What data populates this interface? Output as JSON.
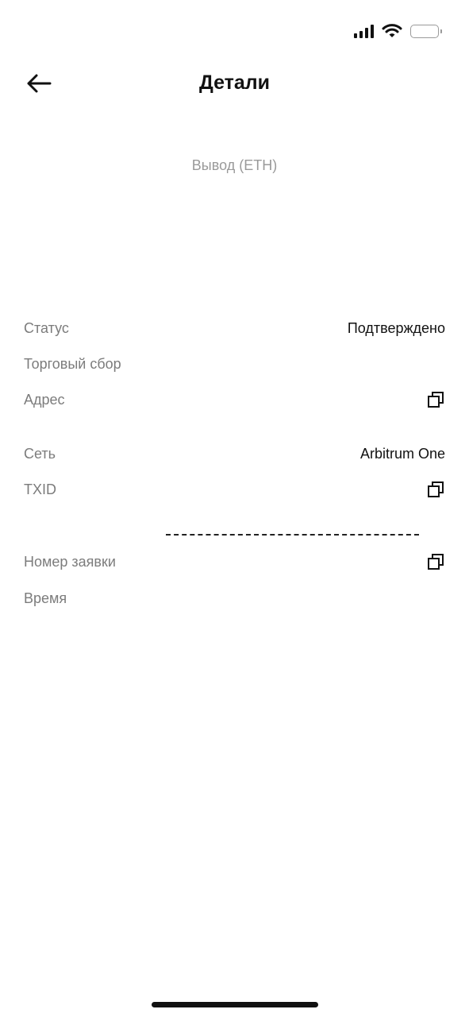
{
  "header": {
    "title": "Детали"
  },
  "subtitle": "Вывод (ETH)",
  "details": {
    "status_label": "Статус",
    "status_value": "Подтверждено",
    "fee_label": "Торговый сбор",
    "address_label": "Адрес",
    "network_label": "Сеть",
    "network_value": "Arbitrum One",
    "txid_label": "TXID",
    "order_label": "Номер заявки",
    "time_label": "Время"
  },
  "icons": {
    "back": "arrow-left-icon",
    "copy": "copy-icon",
    "signal": "cellular-signal-icon",
    "wifi": "wifi-icon",
    "battery": "battery-icon"
  }
}
